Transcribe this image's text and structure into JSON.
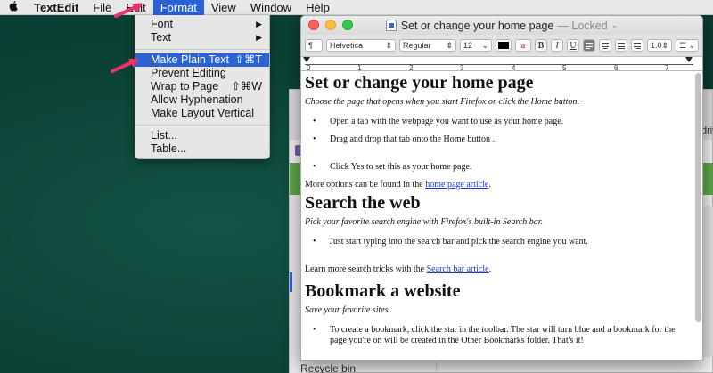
{
  "menubar": {
    "app_name": "TextEdit",
    "items": [
      "File",
      "Edit",
      "Format",
      "View",
      "Window",
      "Help"
    ],
    "active": "Format"
  },
  "format_menu": {
    "items": [
      {
        "label": "Font",
        "shortcut": "",
        "submenu": true
      },
      {
        "label": "Text",
        "shortcut": "",
        "submenu": true
      },
      {
        "label": "Make Plain Text",
        "shortcut": "⇧⌘T",
        "submenu": false,
        "highlighted": true
      },
      {
        "label": "Prevent Editing",
        "shortcut": "",
        "submenu": false
      },
      {
        "label": "Wrap to Page",
        "shortcut": "⇧⌘W",
        "submenu": false
      },
      {
        "label": "Allow Hyphenation",
        "shortcut": "",
        "submenu": false
      },
      {
        "label": "Make Layout Vertical",
        "shortcut": "",
        "submenu": false
      },
      {
        "label": "List...",
        "shortcut": "",
        "submenu": false
      },
      {
        "label": "Table...",
        "shortcut": "",
        "submenu": false
      }
    ]
  },
  "window": {
    "title": "Set or change your home page",
    "status": "— Locked",
    "toolbar": {
      "paragraph_style": "¶",
      "font_family": "Helvetica",
      "font_style": "Regular",
      "font_size": "12",
      "bold": "B",
      "italic": "I",
      "underline": "U",
      "line_spacing": "1.0"
    },
    "ruler_numbers": [
      "0",
      "1",
      "2",
      "3",
      "4",
      "5",
      "6",
      "7"
    ]
  },
  "document": {
    "h1_home": "Set or change your home page",
    "lead_home": "Choose the page that opens when you start Firefox or click the Home button.",
    "bullet_1": "Open a tab with the webpage you want to use as your home page.",
    "bullet_2": "Drag and drop that tab onto the Home button .",
    "bullet_3": "Click Yes to set this as your home page.",
    "more_options_prefix": "More options can be found in the ",
    "more_options_link": "home page article",
    "more_options_suffix": ".",
    "h1_search": "Search the web",
    "lead_search": "Pick your favorite search engine with Firefox's built-in Search bar.",
    "bullet_search": "Just start typing into the search bar and pick the search engine you want.",
    "learn_more_prefix": "Learn more search tricks with the ",
    "learn_more_link": "Search bar article",
    "learn_more_suffix": ".",
    "h1_bookmark": "Bookmark a website",
    "lead_bookmark": "Save your favorite sites.",
    "bullet_bookmark": "To create a bookmark, click the star in the toolbar. The star will turn blue and a bookmark for the page you're on will be created in the Other Bookmarks folder. That's it!"
  },
  "back_window": {
    "recycle_label": "Recycle bin",
    "tab_text": "drive"
  },
  "colors": {
    "accent": "#2a62d6",
    "arrow": "#e8336b",
    "link": "#1a3bd1"
  }
}
